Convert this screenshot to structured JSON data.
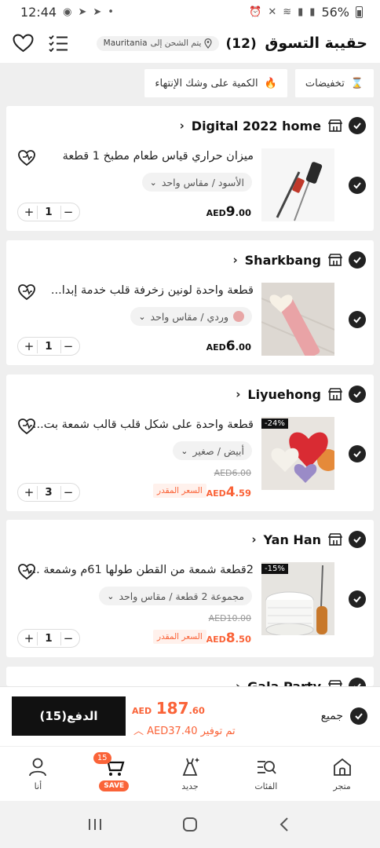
{
  "status": {
    "time": "12:44",
    "battery": "56%"
  },
  "header": {
    "title": "حقيبة التسوق",
    "count": "(12)",
    "shipping_prefix": "يتم الشحن إلى",
    "shipping_place": "Mauritania"
  },
  "chips": [
    {
      "label": "تخفيضات",
      "icon": "hourglass-icon"
    },
    {
      "label": "الكمية على وشك الإنتهاء",
      "icon": "flame-icon"
    }
  ],
  "stores": [
    {
      "name": "Digital 2022 home",
      "item": {
        "title": "ميزان حراري قياس طعام مطبخ 1 قطعة",
        "variant": "الأسود / مقاس واحد",
        "currency": "AED",
        "price_int": "9",
        "price_dec": ".00",
        "qty": "1"
      }
    },
    {
      "name": "Sharkbang",
      "item": {
        "title": "قطعة واحدة لونين زخرفة قلب خدمة إبدا...",
        "variant": "وردي / مقاس واحد",
        "currency": "AED",
        "price_int": "6",
        "price_dec": ".00",
        "qty": "1"
      }
    },
    {
      "name": "Liyuehong",
      "item": {
        "title": "قطعة واحدة على شكل قلب قالب شمعة بت...",
        "variant": "أبيض / صغير",
        "discount": "-24%",
        "old_price": "AED6.00",
        "est_tag": "السعر المقدر",
        "currency": "AED",
        "price_int": "4",
        "price_dec": ".59",
        "qty": "3"
      }
    },
    {
      "name": "Yan Han",
      "item": {
        "title": "2قطعة شمعة من القطن طولها 61م وشمعة ...",
        "variant": "مجموعة 2 قطعة / مقاس واحد",
        "discount": "-15%",
        "old_price": "AED10.00",
        "est_tag": "السعر المقدر",
        "currency": "AED",
        "price_int": "8",
        "price_dec": ".50",
        "qty": "1"
      }
    },
    {
      "name": "Gala Party"
    }
  ],
  "checkout": {
    "select_all": "جميع",
    "pay_label": "الدفع(15)",
    "total_currency": "AED",
    "total_int": "187",
    "total_dec": ".60",
    "save_text": "تم توفير AED37.40"
  },
  "nav": [
    {
      "label": "متجر",
      "icon": "home-icon"
    },
    {
      "label": "الفئات",
      "icon": "categories-icon"
    },
    {
      "label": "جديد",
      "icon": "new-dress-icon"
    },
    {
      "label": "",
      "icon": "cart-icon",
      "badge": "15",
      "tag": "SAVE"
    },
    {
      "label": "أنا",
      "icon": "person-icon"
    }
  ]
}
